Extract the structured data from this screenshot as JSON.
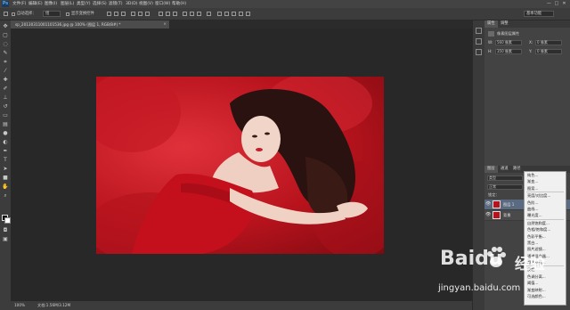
{
  "app": {
    "logo": "Ps"
  },
  "menu": [
    "文件(F)",
    "编辑(E)",
    "图像(I)",
    "图层(L)",
    "类型(Y)",
    "选择(S)",
    "滤镜(T)",
    "3D(D)",
    "视图(V)",
    "窗口(W)",
    "帮助(H)"
  ],
  "window_controls": [
    "—",
    "□",
    "✕"
  ],
  "options": {
    "auto_select_label": "自动选择：",
    "auto_select_value": "组",
    "show_transform_label": "显示变换控件",
    "workspace": "基本功能"
  },
  "document": {
    "tab_label": "sp_20130311001101536.jpg @ 100% (图层 1, RGB/8#) *",
    "tab_close": "×",
    "zoom": "100%",
    "doc_info": "文档:1.56M/3.12M"
  },
  "panels": {
    "properties_tab": "属性",
    "adjustments_tab": "调整",
    "properties_title": "像素图层属性",
    "w_label": "W:",
    "w_value": "560 像素",
    "h_label": "H:",
    "h_value": "350 像素",
    "x_label": "X:",
    "x_value": "0 像素",
    "y_label": "Y:",
    "y_value": "0 像素",
    "layers_tab": "图层",
    "channels_tab": "通道",
    "paths_tab": "路径",
    "kind_label": "类型",
    "blend_mode": "正常",
    "lock_label": "锁定：",
    "layers": [
      {
        "name": "图层 1",
        "eye": "👁"
      },
      {
        "name": "背景",
        "eye": "👁"
      }
    ]
  },
  "context_menu": {
    "groups": [
      [
        "纯色...",
        "渐变...",
        "图案..."
      ],
      [
        "亮度/对比度...",
        "色阶...",
        "曲线...",
        "曝光度..."
      ],
      [
        "自然饱和度...",
        "色相/饱和度...",
        "色彩平衡...",
        "黑白...",
        "照片滤镜...",
        "通道混合器...",
        "颜色查找..."
      ],
      [
        "反相",
        "色调分离...",
        "阈值...",
        "渐变映射...",
        "可选颜色..."
      ]
    ]
  },
  "watermark": {
    "brand": "Baidu",
    "brand_cn": "经验",
    "url": "jingyan.baidu.com"
  }
}
